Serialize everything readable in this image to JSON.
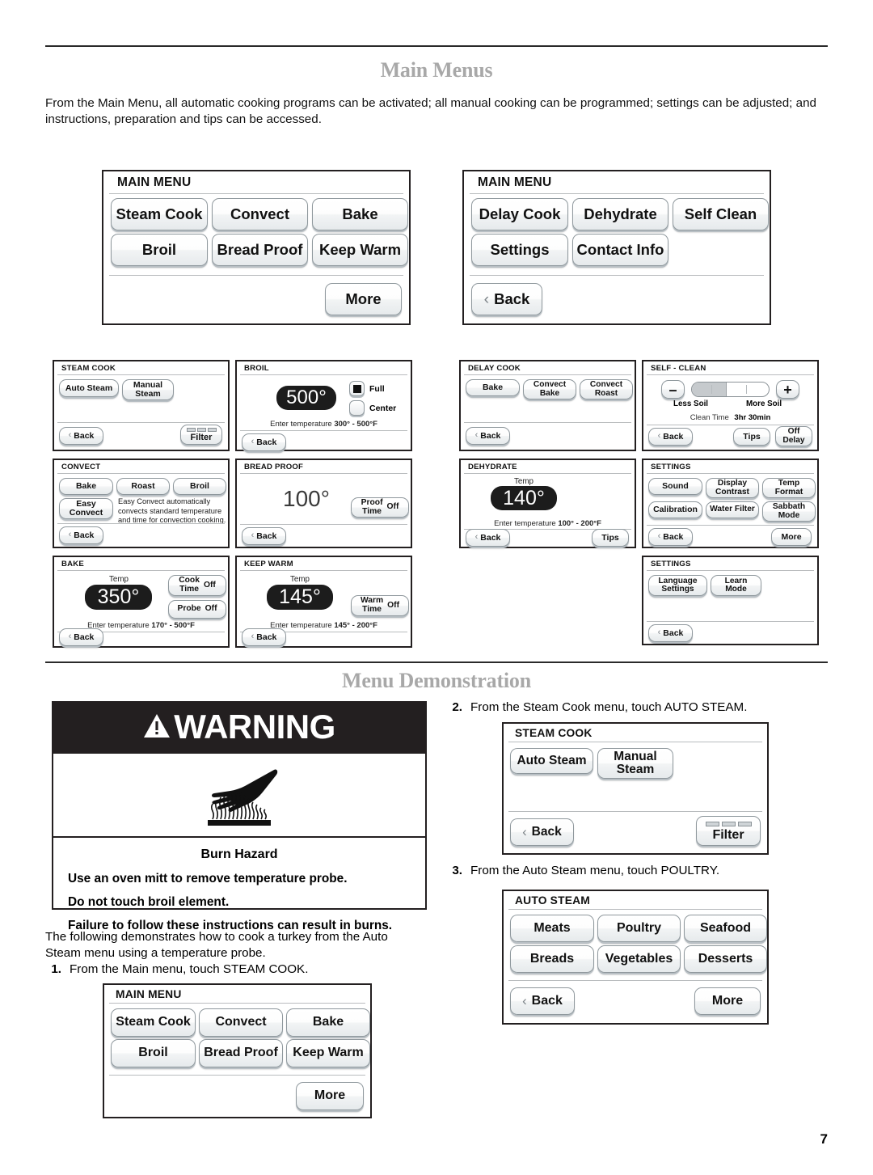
{
  "page": {
    "title": "Main Menus",
    "intro": "From the Main Menu, all automatic cooking programs can be activated; all manual cooking can be programmed; settings can be adjusted; and instructions, preparation and tips can be accessed.",
    "demo_title": "Menu Demonstration",
    "page_number": "7"
  },
  "main_menu_1": {
    "title": "MAIN MENU",
    "buttons": [
      "Steam Cook",
      "Convect",
      "Bake",
      "Broil",
      "Bread Proof",
      "Keep Warm"
    ],
    "more": "More"
  },
  "main_menu_2": {
    "title": "MAIN MENU",
    "buttons": [
      "Delay Cook",
      "Dehydrate",
      "Self Clean",
      "Settings",
      "Contact Info"
    ],
    "back": "Back"
  },
  "steam_cook": {
    "title": "STEAM COOK",
    "auto": "Auto Steam",
    "manual": "Manual\nSteam",
    "back": "Back",
    "filter": "Filter"
  },
  "broil": {
    "title": "BROIL",
    "temp": "500°",
    "full": "Full",
    "center": "Center",
    "range": "Enter temperature 300° - 500°F",
    "range_prefix": "Enter temperature ",
    "range_value": "300° - 500°F",
    "back": "Back"
  },
  "convect": {
    "title": "CONVECT",
    "buttons": [
      "Bake",
      "Roast",
      "Broil"
    ],
    "easy": "Easy\nConvect",
    "note": "Easy Convect automatically convects standard temperature and time for convection cooking.",
    "back": "Back"
  },
  "bread_proof": {
    "title": "BREAD PROOF",
    "temp": "100°",
    "proof_time_label": "Proof\nTime",
    "proof_time_value": "Off",
    "back": "Back"
  },
  "bake": {
    "title": "BAKE",
    "temp_label": "Temp",
    "temp": "350°",
    "cook_time_label": "Cook\nTime",
    "cook_time_value": "Off",
    "probe_label": "Probe",
    "probe_value": "Off",
    "range_prefix": "Enter temperature ",
    "range_value": "170° - 500°F",
    "back": "Back"
  },
  "keep_warm": {
    "title": "KEEP WARM",
    "temp_label": "Temp",
    "temp": "145°",
    "warm_time_label": "Warm\nTime",
    "warm_time_value": "Off",
    "range_prefix": "Enter temperature ",
    "range_value": "145° - 200°F",
    "back": "Back"
  },
  "delay_cook": {
    "title": "DELAY COOK",
    "buttons": [
      "Bake",
      "Convect\nBake",
      "Convect\nRoast"
    ],
    "back": "Back"
  },
  "dehydrate": {
    "title": "DEHYDRATE",
    "temp_label": "Temp",
    "temp": "140°",
    "range_prefix": "Enter temperature ",
    "range_value": "100° - 200°F",
    "back": "Back",
    "tips": "Tips"
  },
  "self_clean": {
    "title": "SELF - CLEAN",
    "minus": "–",
    "plus": "+",
    "less_soil": "Less Soil",
    "more_soil": "More Soil",
    "clean_time_label": "Clean Time",
    "clean_time_value": "3hr  30min",
    "back": "Back",
    "tips": "Tips",
    "off_delay": "Off\nDelay",
    "slider_percent": 45
  },
  "settings_1": {
    "title": "SETTINGS",
    "buttons": [
      "Sound",
      "Display\nContrast",
      "Temp\nFormat",
      "Calibration",
      "Water Filter",
      "Sabbath\nMode"
    ],
    "back": "Back",
    "more": "More"
  },
  "settings_2": {
    "title": "SETTINGS",
    "buttons": [
      "Language\nSettings",
      "Learn\nMode"
    ],
    "back": "Back"
  },
  "warning": {
    "heading": "WARNING",
    "hazard": "Burn Hazard",
    "lines": [
      "Use an oven mitt to remove temperature probe.",
      "Do not touch broil element.",
      "Failure to follow these instructions can result in burns."
    ]
  },
  "demo": {
    "lead": "The following demonstrates how to cook a turkey from the Auto Steam menu using a temperature probe.",
    "steps": [
      {
        "num": "1.",
        "text": "From the Main menu, touch STEAM COOK."
      },
      {
        "num": "2.",
        "text": "From the Steam Cook menu, touch AUTO STEAM."
      },
      {
        "num": "3.",
        "text": "From the Auto Steam menu, touch POULTRY."
      }
    ]
  },
  "demo_main_menu": {
    "title": "MAIN MENU",
    "buttons": [
      "Steam Cook",
      "Convect",
      "Bake",
      "Broil",
      "Bread Proof",
      "Keep Warm"
    ],
    "more": "More"
  },
  "demo_steam_cook": {
    "title": "STEAM COOK",
    "auto": "Auto Steam",
    "manual": "Manual\nSteam",
    "back": "Back",
    "filter": "Filter"
  },
  "auto_steam": {
    "title": "AUTO STEAM",
    "buttons": [
      "Meats",
      "Poultry",
      "Seafood",
      "Breads",
      "Vegetables",
      "Desserts"
    ],
    "back": "Back",
    "more": "More"
  }
}
